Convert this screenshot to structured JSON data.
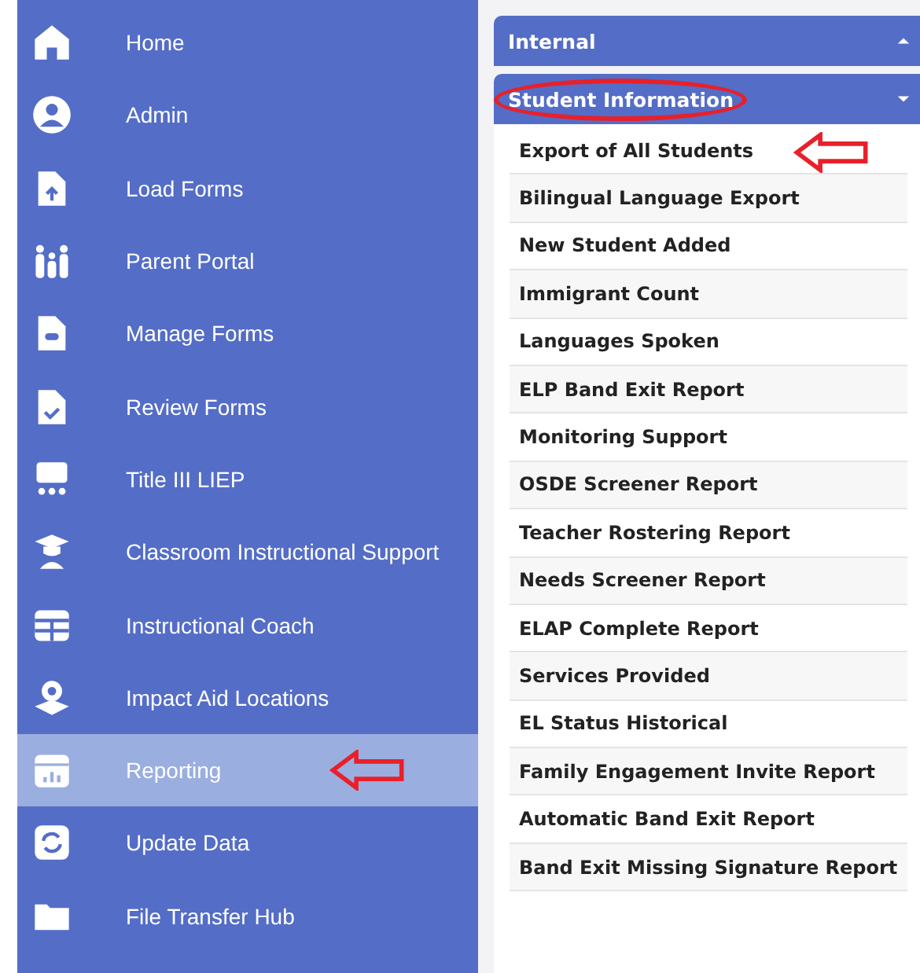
{
  "sidebar": {
    "items": [
      {
        "label": "Home",
        "selected": false
      },
      {
        "label": "Admin",
        "selected": false
      },
      {
        "label": "Load Forms",
        "selected": false
      },
      {
        "label": "Parent Portal",
        "selected": false
      },
      {
        "label": "Manage Forms",
        "selected": false
      },
      {
        "label": "Review Forms",
        "selected": false
      },
      {
        "label": "Title III LIEP",
        "selected": false
      },
      {
        "label": "Classroom Instructional Support",
        "selected": false
      },
      {
        "label": "Instructional Coach",
        "selected": false
      },
      {
        "label": "Impact Aid Locations",
        "selected": false
      },
      {
        "label": "Reporting",
        "selected": true,
        "annotated": true
      },
      {
        "label": "Update Data",
        "selected": false
      },
      {
        "label": "File Transfer Hub",
        "selected": false
      }
    ]
  },
  "panel": {
    "sections": [
      {
        "title": "Internal",
        "expanded": false,
        "circled": false
      },
      {
        "title": "Student Information",
        "expanded": true,
        "circled": true
      }
    ],
    "reports": [
      {
        "label": "Export of All Students",
        "annotated": true
      },
      {
        "label": "Bilingual Language Export"
      },
      {
        "label": "New Student Added"
      },
      {
        "label": "Immigrant Count"
      },
      {
        "label": "Languages Spoken"
      },
      {
        "label": "ELP Band Exit Report"
      },
      {
        "label": "Monitoring Support"
      },
      {
        "label": "OSDE Screener Report"
      },
      {
        "label": "Teacher Rostering Report"
      },
      {
        "label": "Needs Screener Report"
      },
      {
        "label": "ELAP Complete Report"
      },
      {
        "label": "Services Provided"
      },
      {
        "label": "EL Status Historical"
      },
      {
        "label": "Family Engagement Invite Report"
      },
      {
        "label": "Automatic Band Exit Report"
      },
      {
        "label": "Band Exit Missing Signature Report"
      }
    ]
  }
}
